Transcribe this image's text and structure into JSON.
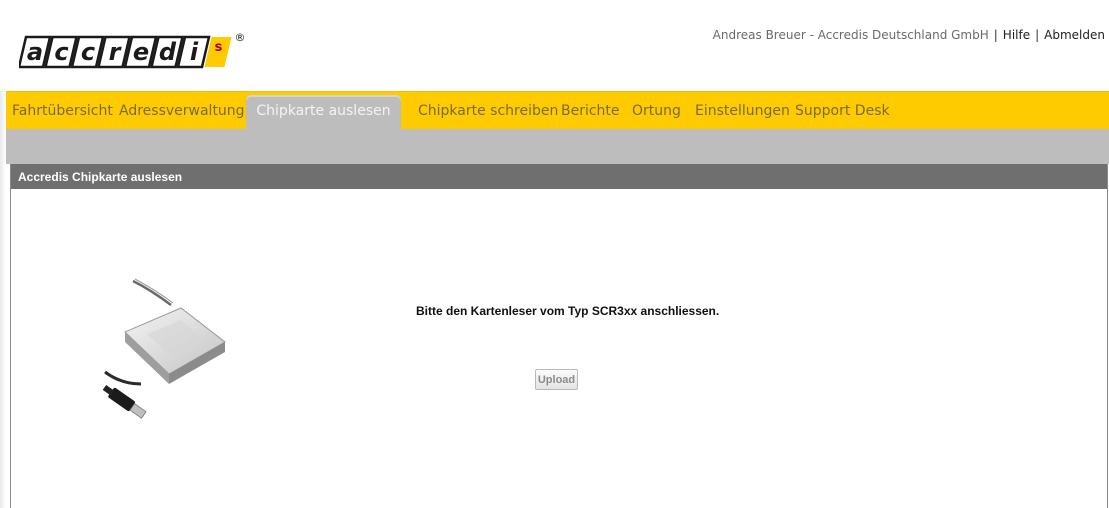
{
  "logo": {
    "letters": [
      "a",
      "c",
      "c",
      "r",
      "e",
      "d",
      "i"
    ],
    "badge": "s",
    "registered": "®"
  },
  "userbar": {
    "user": "Andreas Breuer - Accredis Deutschland GmbH",
    "separator": "|",
    "help": "Hilfe",
    "logout": "Abmelden"
  },
  "nav": {
    "tabs": [
      {
        "label": "Fahrtübersicht"
      },
      {
        "label": "Adressverwaltung"
      },
      {
        "label": "Chipkarte auslesen",
        "active": true
      },
      {
        "label": "Chipkarte schreiben"
      },
      {
        "label": "Berichte"
      },
      {
        "label": "Ortung"
      },
      {
        "label": "Einstellungen"
      },
      {
        "label": "Support Desk"
      }
    ]
  },
  "panel": {
    "title": "Accredis Chipkarte auslesen",
    "message": "Bitte den Kartenleser vom Typ SCR3xx anschliessen.",
    "upload_label": "Upload"
  },
  "colors": {
    "nav_yellow": "#fecb00",
    "active_tab": "#bdbdbd",
    "panel_header": "#6f6f6f"
  },
  "icons": {
    "reader_image": "card-reader-image"
  }
}
